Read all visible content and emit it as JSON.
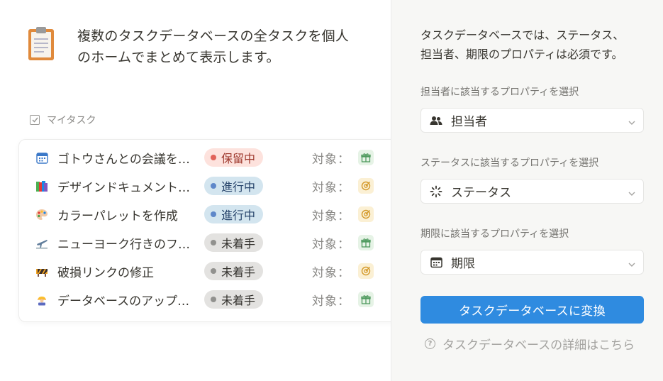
{
  "intro": {
    "line1": "複数のタスクデータベースの全タスクを個人",
    "line2": "のホームでまとめて表示します。",
    "icon": "clipboard-icon"
  },
  "section": {
    "title": "マイタスク",
    "icon": "checkbox-icon"
  },
  "tasks": [
    {
      "title": "ゴトウさんとの会議を…",
      "icon": "calendar-icon",
      "status": "保留中",
      "status_color": "#e16259",
      "status_bg": "#fde2dd",
      "target_label": "対象：",
      "target_icon": "gift-icon"
    },
    {
      "title": "デザインドキュメント…",
      "icon": "books-icon",
      "status": "進行中",
      "status_color": "#5e87c9",
      "status_bg": "#d3e5ef",
      "target_label": "対象：",
      "target_icon": "target-icon"
    },
    {
      "title": "カラーパレットを作成",
      "icon": "palette-icon",
      "status": "進行中",
      "status_color": "#5e87c9",
      "status_bg": "#d3e5ef",
      "target_label": "対象：",
      "target_icon": "target-icon"
    },
    {
      "title": "ニューヨーク行きのフ…",
      "icon": "airplane-icon",
      "status": "未着手",
      "status_color": "#91918e",
      "status_bg": "#e3e2e0",
      "target_label": "対象：",
      "target_icon": "gift-icon"
    },
    {
      "title": "破損リンクの修正",
      "icon": "barrier-icon",
      "status": "未着手",
      "status_color": "#91918e",
      "status_bg": "#e3e2e0",
      "target_label": "対象：",
      "target_icon": "target-icon"
    },
    {
      "title": "データベースのアップ…",
      "icon": "worker-icon",
      "status": "未着手",
      "status_color": "#91918e",
      "status_bg": "#e3e2e0",
      "target_label": "対象：",
      "target_icon": "gift-icon"
    }
  ],
  "right": {
    "desc_line1": "タスクデータベースでは、ステータス、",
    "desc_line2": "担当者、期限のプロパティは必須です。",
    "assignee_label": "担当者に該当するプロパティを選択",
    "assignee_value": "担当者",
    "status_label": "ステータスに該当するプロパティを選択",
    "status_value": "ステータス",
    "due_label": "期限に該当するプロパティを選択",
    "due_value": "期限",
    "convert_button": "タスクデータベースに変換",
    "help_text": "タスクデータベースの詳細はこちら",
    "accent": "#2f8be0"
  }
}
